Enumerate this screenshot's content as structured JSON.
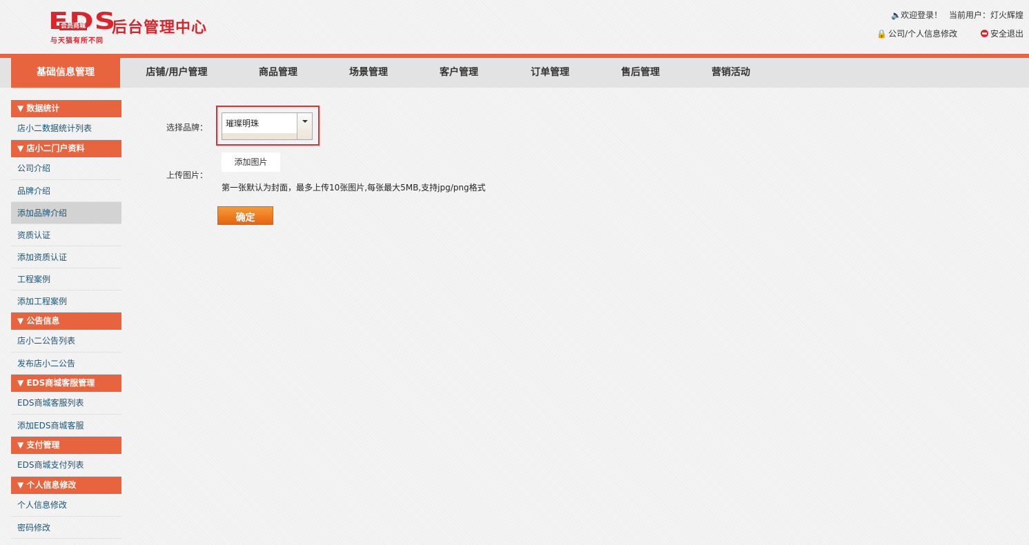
{
  "header": {
    "logo_text": "EDS",
    "logo_sub": "会员商城",
    "logo_slogan": "与天猫有所不同",
    "title": "后台管理中心",
    "welcome": "欢迎登录！",
    "current_user_label": "当前用户：",
    "username": "灯火辉煌",
    "profile_link": "公司/个人信息修改",
    "logout_link": "安全退出"
  },
  "nav": {
    "items": [
      {
        "label": "基础信息管理"
      },
      {
        "label": "店铺/用户管理"
      },
      {
        "label": "商品管理"
      },
      {
        "label": "场景管理"
      },
      {
        "label": "客户管理"
      },
      {
        "label": "订单管理"
      },
      {
        "label": "售后管理"
      },
      {
        "label": "营销活动"
      }
    ],
    "active": "基础信息管理"
  },
  "sidebar": {
    "groups": [
      {
        "title": "▼ 数据统计",
        "items": [
          "店小二数据统计列表"
        ]
      },
      {
        "title": "▼ 店小二门户资料",
        "items": [
          "公司介绍",
          "品牌介绍",
          "添加品牌介绍",
          "资质认证",
          "添加资质认证",
          "工程案例",
          "添加工程案例"
        ]
      },
      {
        "title": "▼ 公告信息",
        "items": [
          "店小二公告列表",
          "发布店小二公告"
        ]
      },
      {
        "title": "▼ EDS商城客服管理",
        "items": [
          "EDS商城客服列表",
          "添加EDS商城客服"
        ]
      },
      {
        "title": "▼ 支付管理",
        "items": [
          "EDS商城支付列表"
        ]
      },
      {
        "title": "▼ 个人信息修改",
        "items": [
          "个人信息修改",
          "密码修改"
        ]
      }
    ],
    "active_item": "添加品牌介绍"
  },
  "form": {
    "brand_label": "选择品牌：",
    "brand_value": "璀璨明珠",
    "upload_label": "上传图片：",
    "add_image_button": "添加图片",
    "upload_hint": "第一张默认为封面，最多上传10张图片,每张最大5MB,支持jpg/png格式",
    "confirm_button": "确定"
  },
  "colors": {
    "accent": "#e8643e",
    "brand_red": "#d8262c",
    "link": "#1a5577",
    "highlight_border": "#e03030"
  }
}
